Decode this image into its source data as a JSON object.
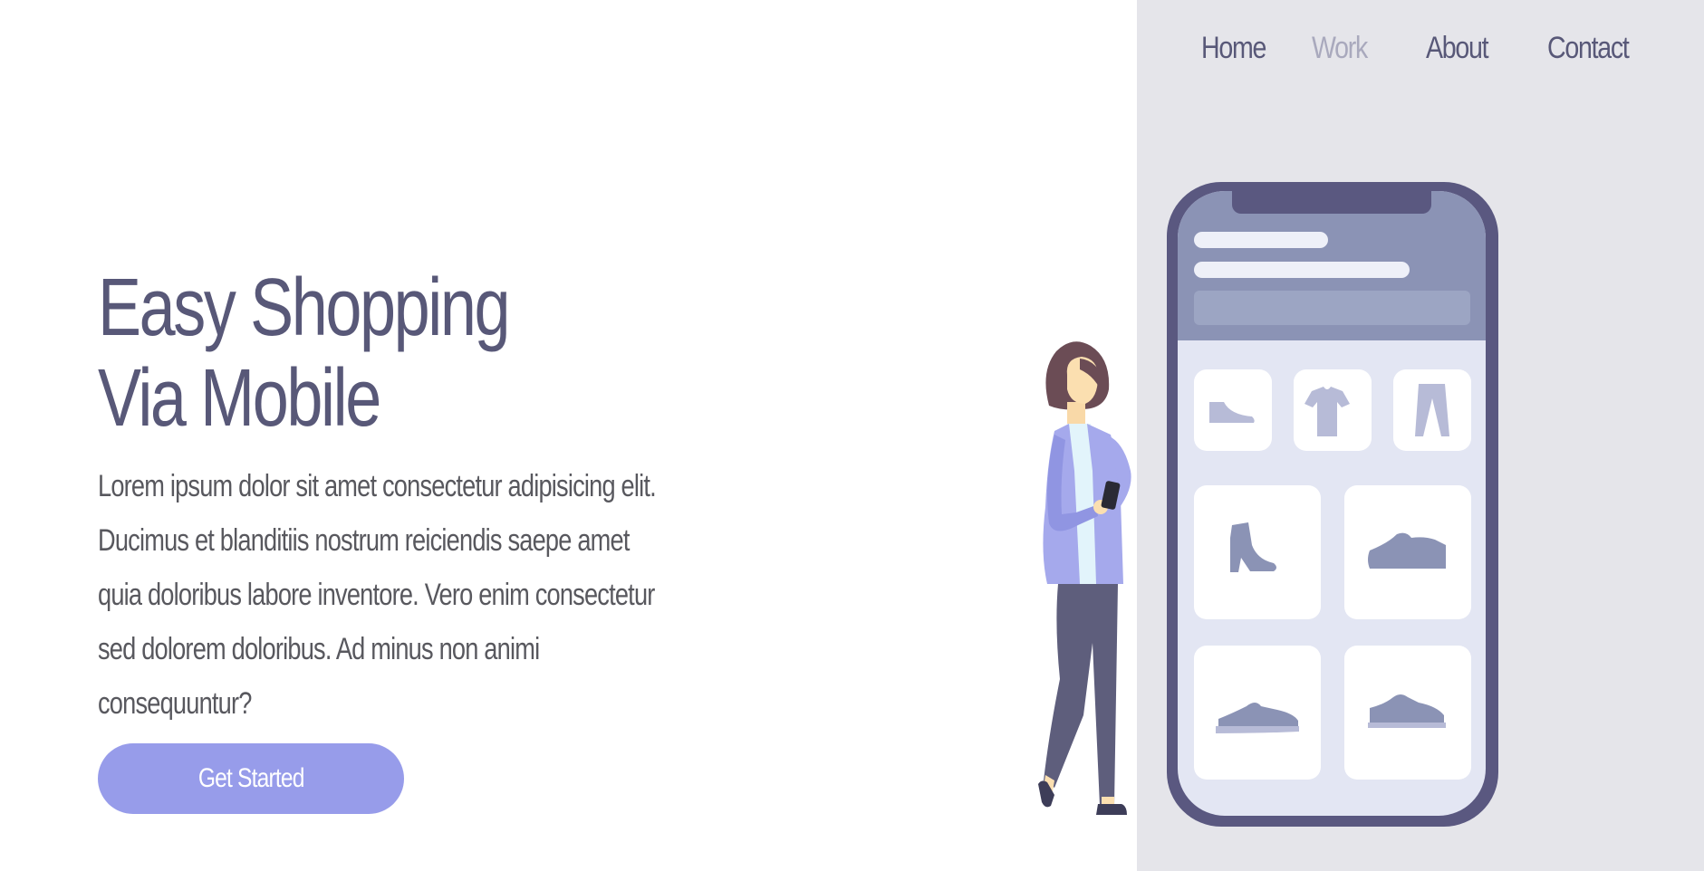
{
  "nav": {
    "items": [
      {
        "label": "Home"
      },
      {
        "label": "Work"
      },
      {
        "label": "About"
      },
      {
        "label": "Contact"
      }
    ]
  },
  "hero": {
    "title_line1": "Easy Shopping",
    "title_line2": "Via Mobile",
    "description": "Lorem ipsum dolor sit amet consectetur adipisicing elit. Ducimus et blanditiis nostrum reiciendis saepe amet quia doloribus labore inventore. Vero enim consectetur sed dolorem doloribus. Ad minus non animi consequuntur?",
    "cta_label": "Get Started"
  },
  "illustration": {
    "products": [
      "shoe-icon",
      "tshirt-icon",
      "pants-icon",
      "boot-icon",
      "sneaker-icon",
      "sneaker-icon",
      "sneaker-icon"
    ]
  },
  "colors": {
    "primary_text": "#585878",
    "nav_inactive": "#a9a9bd",
    "accent": "#979cea",
    "panel_bg": "#e5e5ea",
    "phone_frame": "#5a5880",
    "phone_header": "#8b93b5"
  }
}
